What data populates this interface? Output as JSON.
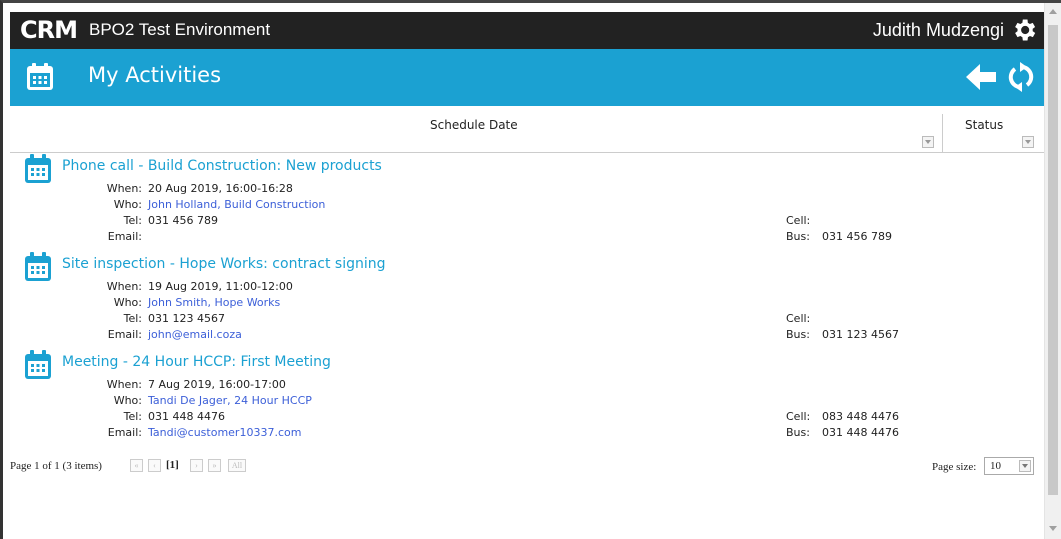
{
  "app": {
    "logo_text": "CRM",
    "environment": "BPO2 Test Environment",
    "user_name": "Judith Mudzengi",
    "icons": {
      "settings": "gear-icon",
      "back": "arrow-left-icon",
      "refresh": "refresh-icon",
      "calendar": "calendar-icon"
    },
    "colors": {
      "topbar": "#222222",
      "accent": "#1ba1d2",
      "link": "#3c5fd8"
    }
  },
  "page": {
    "title": "My Activities"
  },
  "grid": {
    "columns": {
      "schedule_date": "Schedule Date",
      "status": "Status"
    }
  },
  "activities": [
    {
      "title": "Phone call - Build Construction: New products",
      "when_label": "When:",
      "when": "20 Aug 2019, 16:00-16:28",
      "who_label": "Who:",
      "who": "John Holland, Build Construction",
      "tel_label": "Tel:",
      "tel": "031 456 789",
      "email_label": "Email:",
      "email": "",
      "cell_label": "Cell:",
      "cell": "",
      "bus_label": "Bus:",
      "bus": "031 456 789"
    },
    {
      "title": "Site inspection - Hope Works: contract signing",
      "when_label": "When:",
      "when": "19 Aug 2019, 11:00-12:00",
      "who_label": "Who:",
      "who": "John Smith, Hope Works",
      "tel_label": "Tel:",
      "tel": "031 123 4567",
      "email_label": "Email:",
      "email": "john@email.coza",
      "cell_label": "Cell:",
      "cell": "",
      "bus_label": "Bus:",
      "bus": "031 123 4567"
    },
    {
      "title": "Meeting - 24 Hour HCCP: First Meeting",
      "when_label": "When:",
      "when": "7 Aug 2019, 16:00-17:00",
      "who_label": "Who:",
      "who": "Tandi De Jager, 24 Hour HCCP",
      "tel_label": "Tel:",
      "tel": "031 448 4476",
      "email_label": "Email:",
      "email": "Tandi@customer10337.com",
      "cell_label": "Cell:",
      "cell": "083 448 4476",
      "bus_label": "Bus:",
      "bus": "031 448 4476"
    }
  ],
  "pager": {
    "summary": "Page 1 of 1 (3 items)",
    "first": "«",
    "prev": "‹",
    "current": "[1]",
    "next": "›",
    "last": "»",
    "all": "All",
    "page_size_label": "Page size:",
    "page_size": "10"
  }
}
